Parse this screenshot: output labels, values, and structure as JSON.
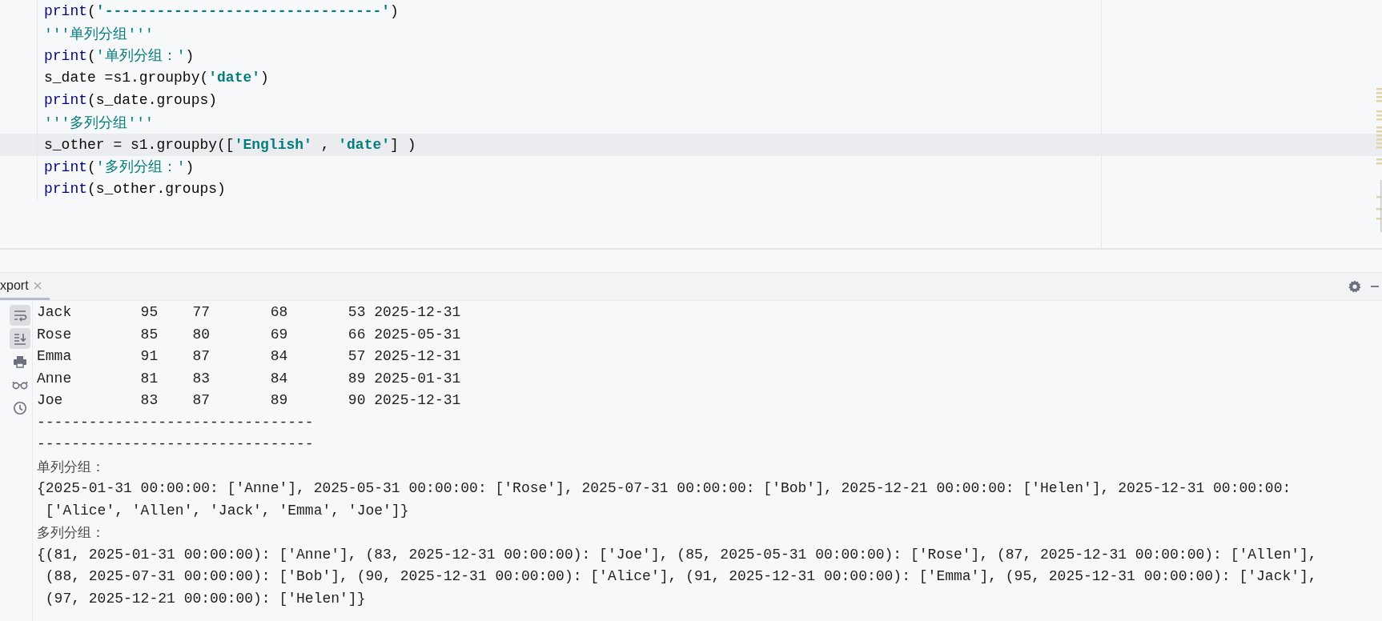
{
  "editor": {
    "lines": [
      {
        "current": false,
        "tokens": [
          {
            "kind": "builtin",
            "text": "print"
          },
          {
            "kind": "text",
            "text": "("
          },
          {
            "kind": "string",
            "text": "'--------------------------------'"
          },
          {
            "kind": "text",
            "text": ")"
          }
        ]
      },
      {
        "current": false,
        "tokens": [
          {
            "kind": "doc",
            "text": "'''单列分组'''"
          }
        ]
      },
      {
        "current": false,
        "tokens": [
          {
            "kind": "builtin",
            "text": "print"
          },
          {
            "kind": "text",
            "text": "("
          },
          {
            "kind": "doc",
            "text": "'单列分组：'"
          },
          {
            "kind": "text",
            "text": ")"
          }
        ]
      },
      {
        "current": false,
        "tokens": [
          {
            "kind": "text",
            "text": "s_date =s1.groupby("
          },
          {
            "kind": "string",
            "text": "'date'"
          },
          {
            "kind": "text",
            "text": ")"
          }
        ]
      },
      {
        "current": false,
        "tokens": [
          {
            "kind": "builtin",
            "text": "print"
          },
          {
            "kind": "text",
            "text": "(s_date.groups)"
          }
        ]
      },
      {
        "current": false,
        "tokens": [
          {
            "kind": "doc",
            "text": "'''多列分组'''"
          }
        ]
      },
      {
        "current": true,
        "tokens": [
          {
            "kind": "text",
            "text": "s_other = s1.groupby(["
          },
          {
            "kind": "string",
            "text": "'English'"
          },
          {
            "kind": "text",
            "text": " , "
          },
          {
            "kind": "string",
            "text": "'date'"
          },
          {
            "kind": "text",
            "text": "] )"
          }
        ]
      },
      {
        "current": false,
        "tokens": [
          {
            "kind": "builtin",
            "text": "print"
          },
          {
            "kind": "text",
            "text": "("
          },
          {
            "kind": "doc",
            "text": "'多列分组：'"
          },
          {
            "kind": "text",
            "text": ")"
          }
        ]
      },
      {
        "current": false,
        "tokens": [
          {
            "kind": "builtin",
            "text": "print"
          },
          {
            "kind": "text",
            "text": "(s_other.groups)"
          }
        ]
      }
    ]
  },
  "run_panel": {
    "tabs": [
      {
        "label": "xport",
        "selected": true
      }
    ],
    "tools": [
      {
        "kind": "wrap",
        "on": true
      },
      {
        "kind": "scroll",
        "on": true
      },
      {
        "kind": "print",
        "on": false
      },
      {
        "kind": "glasses",
        "on": false
      },
      {
        "kind": "clock",
        "on": false
      }
    ],
    "output": [
      {
        "kind": "mono",
        "text": "Jack        95    77       68       53 2025-12-31"
      },
      {
        "kind": "mono",
        "text": "Rose        85    80       69       66 2025-05-31"
      },
      {
        "kind": "mono",
        "text": "Emma        91    87       84       57 2025-12-31"
      },
      {
        "kind": "mono",
        "text": "Anne        81    83       84       89 2025-01-31"
      },
      {
        "kind": "mono",
        "text": "Joe         83    87       89       90 2025-12-31"
      },
      {
        "kind": "mono",
        "text": "--------------------------------"
      },
      {
        "kind": "mono",
        "text": "--------------------------------"
      },
      {
        "kind": "label",
        "text": "单列分组："
      },
      {
        "kind": "mono",
        "text": "{2025-01-31 00:00:00: ['Anne'], 2025-05-31 00:00:00: ['Rose'], 2025-07-31 00:00:00: ['Bob'], 2025-12-21 00:00:00: ['Helen'], 2025-12-31 00:00:00:"
      },
      {
        "kind": "mono",
        "text": " ['Alice', 'Allen', 'Jack', 'Emma', 'Joe']}"
      },
      {
        "kind": "label",
        "text": "多列分组："
      },
      {
        "kind": "mono",
        "text": "{(81, 2025-01-31 00:00:00): ['Anne'], (83, 2025-12-31 00:00:00): ['Joe'], (85, 2025-05-31 00:00:00): ['Rose'], (87, 2025-12-31 00:00:00): ['Allen'],"
      },
      {
        "kind": "mono",
        "text": " (88, 2025-07-31 00:00:00): ['Bob'], (90, 2025-12-31 00:00:00): ['Alice'], (91, 2025-12-31 00:00:00): ['Emma'], (95, 2025-12-31 00:00:00): ['Jack'],"
      },
      {
        "kind": "mono",
        "text": " (97, 2025-12-21 00:00:00): ['Helen']}"
      }
    ]
  }
}
